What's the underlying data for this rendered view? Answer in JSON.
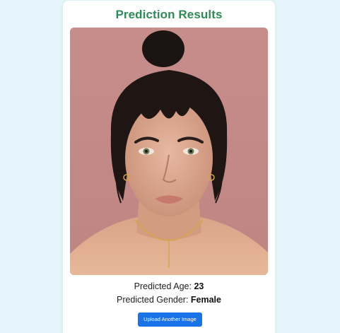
{
  "page": {
    "background_color": "#e6f4fc"
  },
  "card": {
    "title": "Prediction Results",
    "title_color": "#2e8b57",
    "image": {
      "description_icon": "portrait-photo"
    },
    "results": {
      "age_label": "Predicted Age:",
      "age_value": "23",
      "gender_label": "Predicted Gender:",
      "gender_value": "Female"
    },
    "upload_button": {
      "label": "Upload Another Image",
      "color": "#1a73e8"
    }
  }
}
